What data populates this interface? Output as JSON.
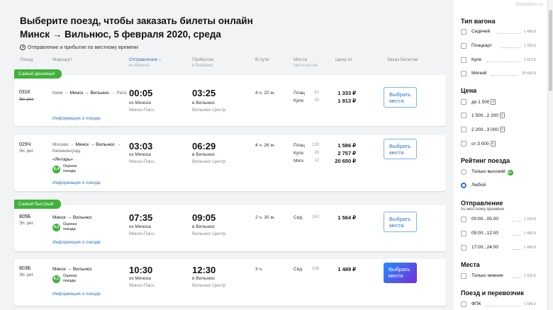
{
  "watermark": "babiabinu.ru",
  "header": {
    "title_line1": "Выберите поезд, чтобы заказать билеты онлайн",
    "title_line2": "Минск → Вильнюс, 5 февраля 2020, среда",
    "tz_note": "Отправление и прибытие по местному времени"
  },
  "columns": {
    "train": "Поезд",
    "route": "Маршрут",
    "departure": "Отправление ↓",
    "departure_sub": "из Минска",
    "arrival": "Прибытие",
    "arrival_sub": "в Вильнюс",
    "duration": "В пути",
    "seats": "Места",
    "seats_sub": "тип и кол-во",
    "price": "Цена от",
    "order": "Заказ билетов"
  },
  "trains": [
    {
      "badge": "Самый дешевый",
      "number": "031К",
      "class": "Эл. рег.",
      "route_pre": "Киев → ",
      "route_cur": "Минск → Вильнюс",
      "route_post": " → Рига",
      "info": "Информация о поезде",
      "dep_time": "00:05",
      "dep_from": "из Минска",
      "dep_station": "Минск-Пасс.",
      "arr_time": "03:25",
      "arr_to": "в Вильнюс",
      "arr_station": "Вильнюс Центр",
      "duration": "4 ч. 20 м.",
      "seats": [
        {
          "type": "Плац",
          "count": "41",
          "price": "1 333 ₽"
        },
        {
          "type": "Купе",
          "count": "30",
          "price": "1 913 ₽"
        }
      ],
      "button": "Выбрать места"
    },
    {
      "number": "029Ч",
      "class": "Эл. рег.",
      "route_pre": "Москва → ",
      "route_cur": "Минск → Вильнюс",
      "route_post": " → Калининград",
      "name": "«Янтарь»",
      "rating": "8,4",
      "rating_text": "Оценка поезда",
      "info": "Информация о поезде",
      "dep_time": "03:03",
      "dep_from": "из Минска",
      "dep_station": "Минск-Пасс.",
      "arr_time": "06:29",
      "arr_to": "в Вильнюс",
      "arr_station": "Вильнюс Центр",
      "duration": "4 ч. 26 м.",
      "seats": [
        {
          "type": "Плац",
          "count": "130",
          "price": "1 586 ₽"
        },
        {
          "type": "Купе",
          "count": "30",
          "price": "2 757 ₽"
        },
        {
          "type": "Мягк",
          "count": "12",
          "price": "20 650 ₽"
        }
      ],
      "button": "Выбрать места"
    },
    {
      "badge": "Самый быстрый",
      "number": "805Б",
      "class": "Эл. рег.",
      "route_cur": "Минск → Вильнюс",
      "rating": "9,2",
      "rating_text": "Оценка поезда",
      "info": "Информация о поезде",
      "dep_time": "07:35",
      "dep_from": "из Минска",
      "dep_station": "Минск-Пасс.",
      "arr_time": "09:05",
      "arr_to": "в Вильнюс",
      "arr_station": "Вильнюс Центр",
      "duration": "2 ч. 30 м.",
      "seats": [
        {
          "type": "Сид",
          "count": "243",
          "price": "1 564 ₽"
        }
      ],
      "button": "Выбрать места"
    },
    {
      "number": "803Б",
      "class": "Эл. рег.",
      "route_cur": "Минск → Вильнюс",
      "rating": "9,1",
      "rating_text": "Оценка поезда",
      "info": "Информация о поезде",
      "dep_time": "10:30",
      "dep_from": "из Минска",
      "dep_station": "Минск-Пасс.",
      "arr_time": "12:30",
      "arr_to": "в Вильнюс",
      "arr_station": "Вильнюс Центр",
      "duration": "3 ч.",
      "seats": [
        {
          "type": "Сид",
          "count": "106",
          "price": "1 489 ₽"
        }
      ],
      "button": "Выбрать места"
    }
  ],
  "filters": {
    "car_type": {
      "title": "Тип вагона",
      "items": [
        {
          "label": "Сидячий",
          "count": "1 489 ₽"
        },
        {
          "label": "Плацкарт",
          "count": "1 333 ₽"
        },
        {
          "label": "Купе",
          "count": "1 913 ₽"
        },
        {
          "label": "Мягкий",
          "count": "20 650 ₽"
        }
      ]
    },
    "price": {
      "title": "Цена",
      "items": [
        {
          "label": "до 1 500"
        },
        {
          "label": "1 500...2 200"
        },
        {
          "label": "2 200...3 000"
        },
        {
          "label": "от 3 000"
        }
      ]
    },
    "rating": {
      "title": "Рейтинг поезда",
      "items": [
        {
          "label": "Только высокий",
          "badge": "9+"
        },
        {
          "label": "Любой",
          "selected": true
        }
      ]
    },
    "departure": {
      "title": "Отправление",
      "subtitle": "по местному времени",
      "items": [
        {
          "label": "00:00...05:00",
          "count": "1 333 ₽"
        },
        {
          "label": "05:00...12:00",
          "count": "1 489 ₽"
        },
        {
          "label": "17:00...24:00",
          "count": "1 489 ₽"
        }
      ]
    },
    "places": {
      "title": "Места",
      "items": [
        {
          "label": "Только нижние",
          "count": "1 333 ₽"
        }
      ]
    },
    "carrier": {
      "title": "Поезд и перевозчик",
      "items": [
        {
          "label": "ФПК",
          "count": "1 586 ₽"
        }
      ]
    }
  }
}
